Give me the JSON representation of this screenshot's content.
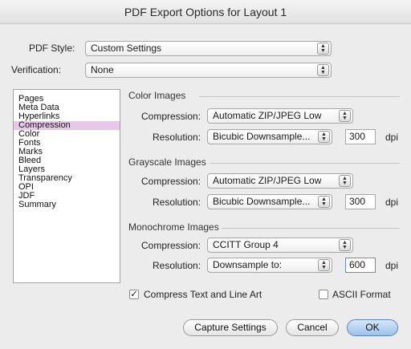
{
  "window": {
    "title": "PDF Export Options for Layout 1"
  },
  "pdf_style": {
    "label": "PDF Style:",
    "value": "Custom Settings"
  },
  "verification": {
    "label": "Verification:",
    "value": "None"
  },
  "sidebar": {
    "items": [
      {
        "label": "Pages"
      },
      {
        "label": "Meta Data"
      },
      {
        "label": "Hyperlinks"
      },
      {
        "label": "Compression"
      },
      {
        "label": "Color"
      },
      {
        "label": "Fonts"
      },
      {
        "label": "Marks"
      },
      {
        "label": "Bleed"
      },
      {
        "label": "Layers"
      },
      {
        "label": "Transparency"
      },
      {
        "label": "OPI"
      },
      {
        "label": "JDF"
      },
      {
        "label": "Summary"
      }
    ],
    "selected": "Compression"
  },
  "color_images": {
    "title": "Color Images",
    "compression_label": "Compression:",
    "compression": "Automatic ZIP/JPEG Low",
    "resolution_label": "Resolution:",
    "resolution_method": "Bicubic Downsample...",
    "resolution_value": "300",
    "unit": "dpi"
  },
  "grayscale_images": {
    "title": "Grayscale Images",
    "compression_label": "Compression:",
    "compression": "Automatic ZIP/JPEG Low",
    "resolution_label": "Resolution:",
    "resolution_method": "Bicubic Downsample...",
    "resolution_value": "300",
    "unit": "dpi"
  },
  "monochrome_images": {
    "title": "Monochrome Images",
    "compression_label": "Compression:",
    "compression": "CCITT Group 4",
    "resolution_label": "Resolution:",
    "resolution_method": "Downsample to:",
    "resolution_value": "600",
    "unit": "dpi"
  },
  "options": {
    "compress_text": {
      "label": "Compress Text and Line Art",
      "checked": true
    },
    "ascii_format": {
      "label": "ASCII Format",
      "checked": false
    }
  },
  "buttons": {
    "capture": "Capture Settings",
    "cancel": "Cancel",
    "ok": "OK"
  }
}
